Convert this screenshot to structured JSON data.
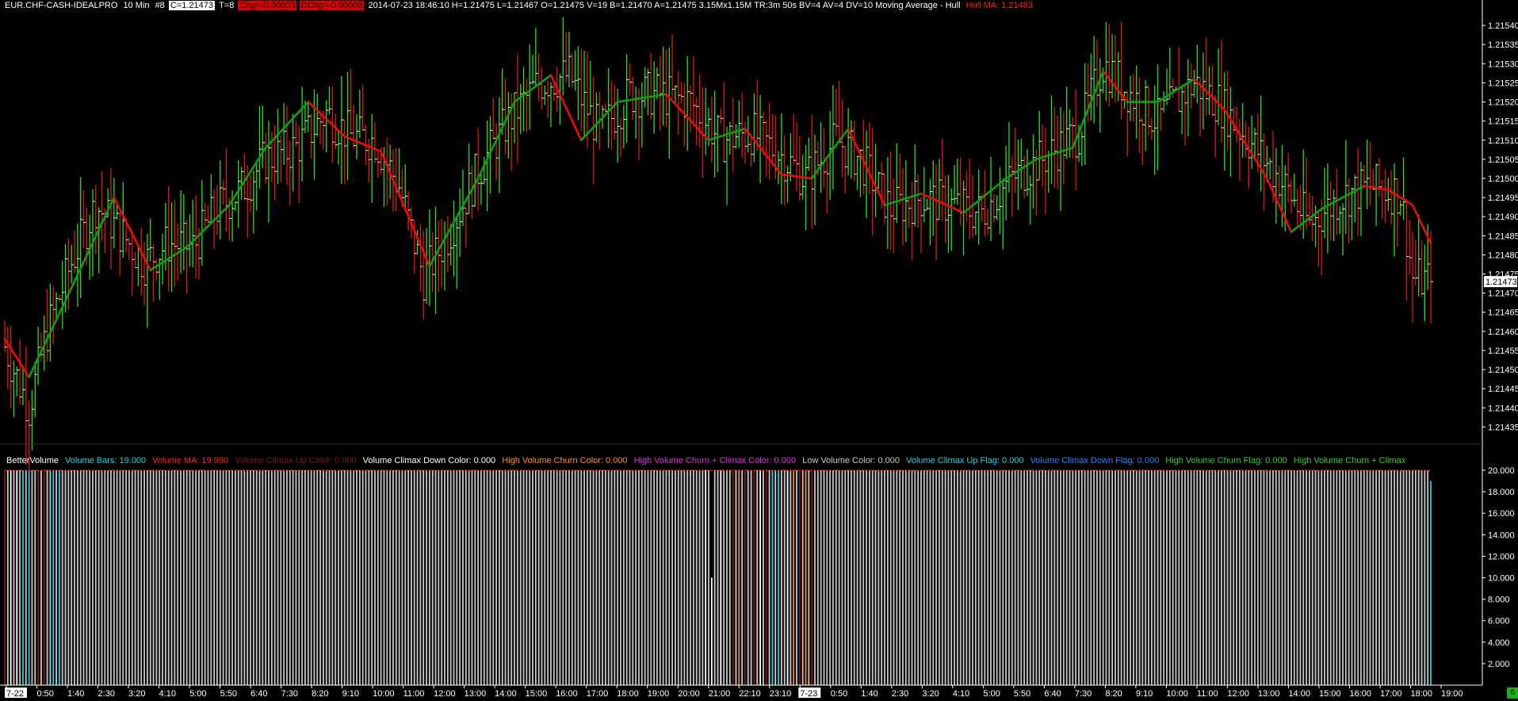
{
  "header": {
    "symbol": "EUR.CHF-CASH-IDEALPRO",
    "interval": "10 Min",
    "chart_no": "#8",
    "close_box": "C=1.21473",
    "ticks": "T=8",
    "chg_box": "Chg=-0.00003",
    "dchg_box": "DChg=-0.00008",
    "stats": "2014-07-23 18:46:10 H=1.21475 L=1.21467 O=1.21475 V=19 B=1.21470 A=1.21475 3.15Mx1.15M TR:3m 50s BV=4 AV=4 DV=10 Moving Average - Hull",
    "hull_label": "Hull MA: 1.21483"
  },
  "price_axis": {
    "ticks": [
      "1.21540",
      "1.21535",
      "1.21530",
      "1.21525",
      "1.21520",
      "1.21515",
      "1.21510",
      "1.21505",
      "1.21500",
      "1.21495",
      "1.21490",
      "1.21485",
      "1.21480",
      "1.21475",
      "1.21470",
      "1.21465",
      "1.21460",
      "1.21455",
      "1.21450",
      "1.21445",
      "1.21440",
      "1.21435"
    ],
    "last_price": "1.21473"
  },
  "volume_header": [
    {
      "text": "BetterVolume",
      "color": "#ffffff"
    },
    {
      "text": "Volume Bars: 19.000",
      "color": "#19d3e0"
    },
    {
      "text": "Volume MA: 19.990",
      "color": "#ff2020"
    },
    {
      "text": "Volume Climax Up Color: 0.000",
      "color": "#7a1a1a"
    },
    {
      "text": "Volume Climax Down Color: 0.000",
      "color": "#ffffff"
    },
    {
      "text": "High Volume Churn Color: 0.000",
      "color": "#ff8c1a"
    },
    {
      "text": "High Volume Churn + Climax Color: 0.000",
      "color": "#e030e0"
    },
    {
      "text": "Low Volume Color: 0.000",
      "color": "#c8c8c8"
    },
    {
      "text": "Volume Climax Up Flag: 0.000",
      "color": "#19d3e0"
    },
    {
      "text": "Volume Climax Down Flag: 0.000",
      "color": "#2a7fff"
    },
    {
      "text": "High Volume Churn Flag: 0.000",
      "color": "#2ed02e"
    },
    {
      "text": "High Volume Churn + Climax",
      "color": "#2ed02e"
    }
  ],
  "volume_axis": {
    "ticks": [
      "20.000",
      "18.000",
      "16.000",
      "14.000",
      "12.000",
      "10.000",
      "8.000",
      "6.000",
      "4.000",
      "2.000"
    ]
  },
  "time_axis": {
    "labels": [
      {
        "t": "7-22",
        "boxed": true
      },
      {
        "t": "0:50"
      },
      {
        "t": "1:40"
      },
      {
        "t": "2:30"
      },
      {
        "t": "3:20"
      },
      {
        "t": "4:10"
      },
      {
        "t": "5:00"
      },
      {
        "t": "5:50"
      },
      {
        "t": "6:40"
      },
      {
        "t": "7:30"
      },
      {
        "t": "8:20"
      },
      {
        "t": "9:10"
      },
      {
        "t": "10:00"
      },
      {
        "t": "11:00"
      },
      {
        "t": "12:00"
      },
      {
        "t": "13:00"
      },
      {
        "t": "14:00"
      },
      {
        "t": "15:00"
      },
      {
        "t": "16:00"
      },
      {
        "t": "17:00"
      },
      {
        "t": "18:00"
      },
      {
        "t": "19:00"
      },
      {
        "t": "20:00"
      },
      {
        "t": "21:00"
      },
      {
        "t": "22:10"
      },
      {
        "t": "23:10"
      },
      {
        "t": "7-23",
        "boxed": true
      },
      {
        "t": "0:50"
      },
      {
        "t": "1:40"
      },
      {
        "t": "2:30"
      },
      {
        "t": "3:20"
      },
      {
        "t": "4:10"
      },
      {
        "t": "5:00"
      },
      {
        "t": "5:50"
      },
      {
        "t": "6:40"
      },
      {
        "t": "7:30"
      },
      {
        "t": "8:20"
      },
      {
        "t": "9:10"
      },
      {
        "t": "10:00"
      },
      {
        "t": "11:00"
      },
      {
        "t": "12:00"
      },
      {
        "t": "13:00"
      },
      {
        "t": "14:00"
      },
      {
        "t": "15:00"
      },
      {
        "t": "16:00"
      },
      {
        "t": "17:00"
      },
      {
        "t": "18:00"
      },
      {
        "t": "19:00"
      }
    ]
  },
  "colors": {
    "up": "#22e022",
    "down": "#e01818",
    "hull_up": "#0fa00f",
    "hull_down": "#ee0a0a",
    "vol_low": "#c8c8c8",
    "vol_flag_up": "#19d3e0",
    "vol_climax_up": "#7a1a1a",
    "vol_climax_down": "#ffffff",
    "vol_churn": "#ff8c1a",
    "vol_ma": "#ff2020",
    "axis": "#ffffff"
  },
  "corner_badge": "6",
  "chart_data": [
    {
      "type": "ohlc-bars",
      "title": "EUR.CHF-CASH-IDEALPRO 10 Min",
      "ylim": [
        1.21433,
        1.21545
      ],
      "price_keypoints": [
        [
          0,
          1.21456
        ],
        [
          8,
          1.2144
        ],
        [
          14,
          1.2146
        ],
        [
          22,
          1.21478
        ],
        [
          30,
          1.21493
        ],
        [
          38,
          1.21486
        ],
        [
          46,
          1.21478
        ],
        [
          54,
          1.21483
        ],
        [
          62,
          1.21482
        ],
        [
          70,
          1.21492
        ],
        [
          78,
          1.21497
        ],
        [
          86,
          1.21505
        ],
        [
          96,
          1.21508
        ],
        [
          106,
          1.21517
        ],
        [
          114,
          1.21511
        ],
        [
          122,
          1.2151
        ],
        [
          130,
          1.21498
        ],
        [
          138,
          1.21474
        ],
        [
          146,
          1.21485
        ],
        [
          156,
          1.21502
        ],
        [
          166,
          1.21515
        ],
        [
          176,
          1.21525
        ],
        [
          186,
          1.21527
        ],
        [
          196,
          1.21512
        ],
        [
          206,
          1.21522
        ],
        [
          216,
          1.21522
        ],
        [
          226,
          1.2152
        ],
        [
          236,
          1.2151
        ],
        [
          246,
          1.21512
        ],
        [
          256,
          1.21506
        ],
        [
          264,
          1.215
        ],
        [
          274,
          1.2151
        ],
        [
          282,
          1.21505
        ],
        [
          292,
          1.21492
        ],
        [
          302,
          1.21495
        ],
        [
          312,
          1.21493
        ],
        [
          322,
          1.21491
        ],
        [
          332,
          1.215
        ],
        [
          342,
          1.21505
        ],
        [
          354,
          1.21512
        ],
        [
          362,
          1.2153
        ],
        [
          370,
          1.21523
        ],
        [
          380,
          1.21515
        ],
        [
          392,
          1.21525
        ],
        [
          400,
          1.2152
        ],
        [
          410,
          1.2151
        ],
        [
          420,
          1.215
        ],
        [
          430,
          1.21488
        ],
        [
          440,
          1.21495
        ],
        [
          450,
          1.21498
        ],
        [
          460,
          1.21496
        ],
        [
          464,
          1.21474
        ],
        [
          470,
          1.21473
        ]
      ],
      "bar_count": 471,
      "last_close": 1.21473
    },
    {
      "type": "line",
      "name": "Hull MA",
      "last_value": 1.21483,
      "keypoints": [
        [
          0,
          1.21458
        ],
        [
          8,
          1.21448
        ],
        [
          20,
          1.21468
        ],
        [
          36,
          1.21495
        ],
        [
          48,
          1.21476
        ],
        [
          60,
          1.21482
        ],
        [
          74,
          1.21493
        ],
        [
          86,
          1.21508
        ],
        [
          100,
          1.2152
        ],
        [
          112,
          1.21511
        ],
        [
          124,
          1.21507
        ],
        [
          140,
          1.21477
        ],
        [
          156,
          1.215
        ],
        [
          168,
          1.2152
        ],
        [
          180,
          1.21527
        ],
        [
          190,
          1.2151
        ],
        [
          202,
          1.2152
        ],
        [
          218,
          1.21522
        ],
        [
          232,
          1.2151
        ],
        [
          244,
          1.21513
        ],
        [
          256,
          1.21501
        ],
        [
          266,
          1.215
        ],
        [
          278,
          1.21513
        ],
        [
          290,
          1.21493
        ],
        [
          302,
          1.21496
        ],
        [
          316,
          1.21491
        ],
        [
          330,
          1.215
        ],
        [
          340,
          1.21505
        ],
        [
          352,
          1.21508
        ],
        [
          362,
          1.21528
        ],
        [
          370,
          1.2152
        ],
        [
          380,
          1.2152
        ],
        [
          392,
          1.21526
        ],
        [
          402,
          1.21518
        ],
        [
          416,
          1.215
        ],
        [
          424,
          1.21486
        ],
        [
          434,
          1.21492
        ],
        [
          448,
          1.21498
        ],
        [
          456,
          1.21497
        ],
        [
          464,
          1.21493
        ],
        [
          470,
          1.21483
        ]
      ]
    },
    {
      "type": "bar",
      "name": "BetterVolume",
      "ylim": [
        0,
        20
      ],
      "typical_value": 20,
      "last_value": 19,
      "ma_value": 19.99,
      "special_bars": [
        {
          "i": 0,
          "v": 20,
          "c": "vol_climax_up"
        },
        {
          "i": 2,
          "v": 20,
          "c": "vol_climax_down"
        },
        {
          "i": 4,
          "v": 20,
          "c": "vol_climax_down"
        },
        {
          "i": 6,
          "v": 20,
          "c": "vol_flag_up"
        },
        {
          "i": 8,
          "v": 20,
          "c": "vol_flag_up"
        },
        {
          "i": 11,
          "v": 20,
          "c": "vol_climax_up"
        },
        {
          "i": 13,
          "v": 20,
          "c": "vol_climax_up"
        },
        {
          "i": 16,
          "v": 20,
          "c": "vol_flag_up"
        },
        {
          "i": 18,
          "v": 20,
          "c": "vol_flag_up"
        },
        {
          "i": 231,
          "v": 20,
          "c": "vol_climax_down"
        },
        {
          "i": 233,
          "v": 10,
          "c": "vol_climax_down"
        },
        {
          "i": 236,
          "v": 20,
          "c": "vol_climax_down"
        },
        {
          "i": 240,
          "v": 20,
          "c": "vol_climax_up"
        },
        {
          "i": 242,
          "v": 20,
          "c": "vol_churn"
        },
        {
          "i": 244,
          "v": 20,
          "c": "vol_climax_up"
        },
        {
          "i": 247,
          "v": 20,
          "c": "vol_climax_up"
        },
        {
          "i": 249,
          "v": 20,
          "c": "vol_climax_down"
        },
        {
          "i": 251,
          "v": 20,
          "c": "vol_climax_up"
        },
        {
          "i": 253,
          "v": 20,
          "c": "vol_flag_up"
        },
        {
          "i": 255,
          "v": 20,
          "c": "vol_flag_up"
        },
        {
          "i": 258,
          "v": 20,
          "c": "vol_climax_down"
        },
        {
          "i": 260,
          "v": 20,
          "c": "vol_churn"
        },
        {
          "i": 262,
          "v": 20,
          "c": "vol_climax_up"
        },
        {
          "i": 264,
          "v": 20,
          "c": "vol_churn"
        },
        {
          "i": 266,
          "v": 20,
          "c": "vol_climax_up"
        },
        {
          "i": 470,
          "v": 19,
          "c": "vol_flag_up"
        }
      ]
    }
  ]
}
